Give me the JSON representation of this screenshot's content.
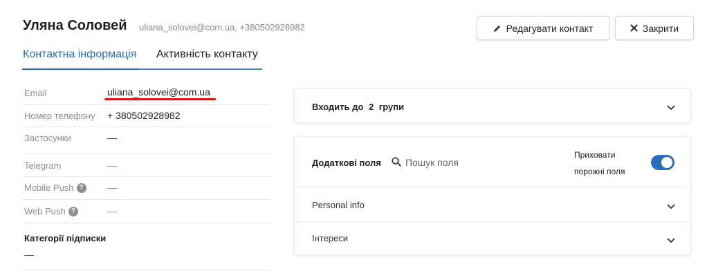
{
  "header": {
    "name": "Уляна Соловей",
    "subtitle": "uliana_solovei@com.ua, +380502928982",
    "edit_label": "Редагувати контакт",
    "close_label": "Закрити"
  },
  "tabs": [
    {
      "label": "Контактна інформація",
      "active": true
    },
    {
      "label": "Активність контакту",
      "active": false
    }
  ],
  "fields": {
    "email_label": "Email",
    "email_value": "uliana_solovei@com.ua",
    "phone_label": "Номер телефону",
    "phone_value": "+ 380502928982",
    "apps_label": "Застосунки",
    "apps_value": "—",
    "telegram_label": "Telegram",
    "telegram_value": "—",
    "mobile_push_label": "Mobile Push",
    "mobile_push_value": "—",
    "web_push_label": "Web Push",
    "web_push_value": "—",
    "help_glyph": "?"
  },
  "subscriptions": {
    "title": "Категорії підписки",
    "value": "—"
  },
  "groups": {
    "prefix": "Входить до",
    "count": "2",
    "suffix": "групи"
  },
  "extra_fields": {
    "title": "Додаткові поля",
    "search_placeholder": "Пошук поля",
    "hide_empty_line1": "Приховати",
    "hide_empty_line2": "порожні поля",
    "hide_empty_on": true,
    "sections": [
      "Personal info",
      "Інтереси"
    ]
  },
  "colors": {
    "accent": "#2a6ebd",
    "highlight_underline": "#e01616"
  }
}
